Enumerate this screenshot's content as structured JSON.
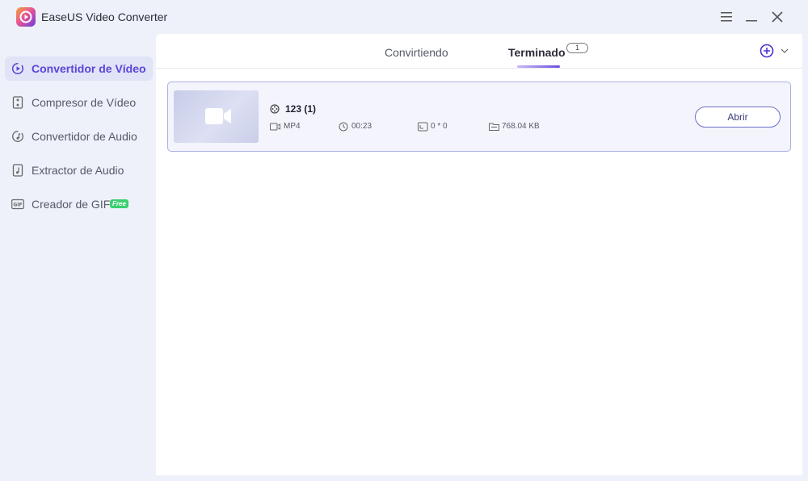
{
  "app": {
    "title": "EaseUS Video Converter",
    "logo_icon": "easeus-logo-icon"
  },
  "window_controls": [
    "menu-icon",
    "minimize-icon",
    "close-icon"
  ],
  "sidebar": {
    "items": [
      {
        "label": "Convertidor de Vídeo",
        "icon": "video-convert-icon",
        "active": true
      },
      {
        "label": "Compresor de Vídeo",
        "icon": "compress-icon",
        "active": false
      },
      {
        "label": "Convertidor de Audio",
        "icon": "audio-convert-icon",
        "active": false
      },
      {
        "label": "Extractor de Audio",
        "icon": "audio-extract-icon",
        "active": false
      },
      {
        "label": "Creador de GIF",
        "icon": "gif-icon",
        "active": false,
        "badge": "Free"
      }
    ]
  },
  "tabs": {
    "converting": "Convirtiendo",
    "finished": "Terminado",
    "finished_count": "1"
  },
  "file": {
    "name": "123 (1)",
    "format": "MP4",
    "duration": "00:23",
    "resolution": "0 * 0",
    "size": "768.04 KB",
    "open_label": "Abrir"
  },
  "colors": {
    "accent": "#5b45d8",
    "active_bg": "#e1e3f7",
    "card_border": "#aab0e6",
    "free_badge": "#3ccf72"
  }
}
